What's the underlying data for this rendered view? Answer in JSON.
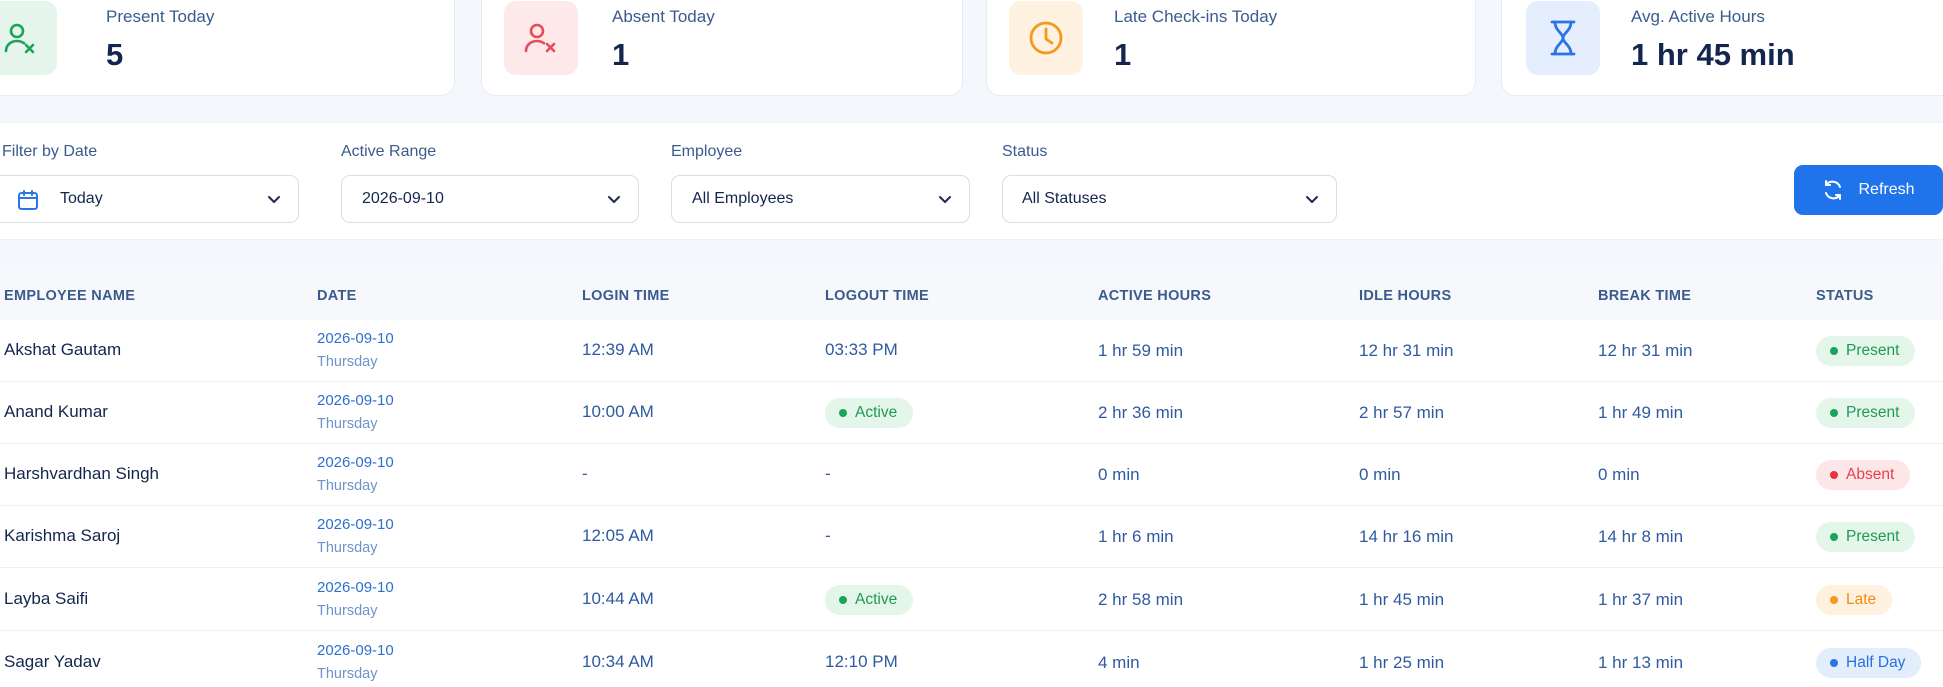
{
  "stats": [
    {
      "label": "Present Today",
      "value": "5",
      "icon": "user-check-icon",
      "color": "#1aa35a",
      "bg": "#e6f5ec"
    },
    {
      "label": "Absent Today",
      "value": "1",
      "icon": "user-x-icon",
      "color": "#e84a57",
      "bg": "#fde8ea"
    },
    {
      "label": "Late Check-ins Today",
      "value": "1",
      "icon": "clock-icon",
      "color": "#f39a1e",
      "bg": "#fff2e0"
    },
    {
      "label": "Avg. Active Hours",
      "value": "1 hr 45 min",
      "icon": "hourglass-icon",
      "color": "#2a74e6",
      "bg": "#e5eefc"
    }
  ],
  "filters": {
    "date_label": "Filter by Date",
    "date_value": "Today",
    "range_label": "Active Range",
    "range_value": "2026-09-10",
    "employee_label": "Employee",
    "employee_value": "All Employees",
    "status_label": "Status",
    "status_value": "All Statuses",
    "refresh_label": "Refresh"
  },
  "table": {
    "columns": [
      "EMPLOYEE NAME",
      "DATE",
      "LOGIN TIME",
      "LOGOUT TIME",
      "ACTIVE HOURS",
      "IDLE HOURS",
      "BREAK TIME",
      "STATUS"
    ],
    "rows": [
      {
        "name": "Akshat Gautam",
        "date": "2026-09-10",
        "day": "Thursday",
        "login": "12:39 AM",
        "logout": "03:33 PM",
        "logout_active": false,
        "active": "1 hr 59 min",
        "idle": "12 hr 31 min",
        "break": "12 hr 31 min",
        "status": "Present"
      },
      {
        "name": "Anand Kumar",
        "date": "2026-09-10",
        "day": "Thursday",
        "login": "10:00 AM",
        "logout": "Active",
        "logout_active": true,
        "active": "2 hr 36 min",
        "idle": "2 hr 57 min",
        "break": "1 hr 49 min",
        "status": "Present"
      },
      {
        "name": "Harshvardhan Singh",
        "date": "2026-09-10",
        "day": "Thursday",
        "login": "-",
        "logout": "-",
        "logout_active": false,
        "active": "0 min",
        "idle": "0 min",
        "break": "0 min",
        "status": "Absent"
      },
      {
        "name": "Karishma Saroj",
        "date": "2026-09-10",
        "day": "Thursday",
        "login": "12:05 AM",
        "logout": "-",
        "logout_active": false,
        "active": "1 hr 6 min",
        "idle": "14 hr 16 min",
        "break": "14 hr 8 min",
        "status": "Present"
      },
      {
        "name": "Layba Saifi",
        "date": "2026-09-10",
        "day": "Thursday",
        "login": "10:44 AM",
        "logout": "Active",
        "logout_active": true,
        "active": "2 hr 58 min",
        "idle": "1 hr 45 min",
        "break": "1 hr 37 min",
        "status": "Late"
      },
      {
        "name": "Sagar Yadav",
        "date": "2026-09-10",
        "day": "Thursday",
        "login": "10:34 AM",
        "logout": "12:10 PM",
        "logout_active": false,
        "active": "4 min",
        "idle": "1 hr 25 min",
        "break": "1 hr 13 min",
        "status": "Half Day"
      }
    ]
  },
  "status_colors": {
    "Present": {
      "bg": "#e4f5ea",
      "fg": "#1f9a55",
      "dot": "#1aa35a"
    },
    "Absent": {
      "bg": "#fde6e8",
      "fg": "#e3414f",
      "dot": "#e8333f"
    },
    "Late": {
      "bg": "#fff1df",
      "fg": "#ef8f12",
      "dot": "#f39a1e"
    },
    "Half Day": {
      "bg": "#e3eefc",
      "fg": "#2a6fdc",
      "dot": "#2a74e6"
    },
    "Active": {
      "bg": "#e4f5ea",
      "fg": "#1f9a55",
      "dot": "#1aa35a"
    }
  }
}
